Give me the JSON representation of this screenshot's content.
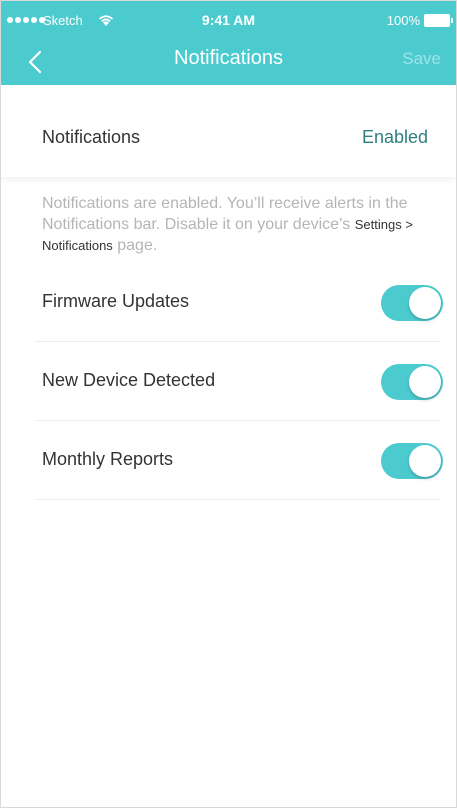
{
  "status_bar": {
    "carrier": "Sketch",
    "time": "9:41 AM",
    "battery": "100%"
  },
  "nav": {
    "title": "Notifications",
    "save_label": "Save",
    "back_icon": "chevron-left-icon"
  },
  "notifications": {
    "label": "Notifications",
    "value": "Enabled"
  },
  "description": {
    "text_before": "Notifications are enabled. You’ll receive alerts in the Notifications bar. Disable it on your device’s ",
    "path": "Settings > Notifications",
    "text_after": " page."
  },
  "toggles": [
    {
      "label": "Firmware Updates",
      "on": true
    },
    {
      "label": "New Device Detected",
      "on": true
    },
    {
      "label": "Monthly Reports",
      "on": true
    }
  ],
  "colors": {
    "accent": "#4ccbcf",
    "enabled_text": "#2e7f80",
    "save_disabled": "#9de4e6"
  }
}
